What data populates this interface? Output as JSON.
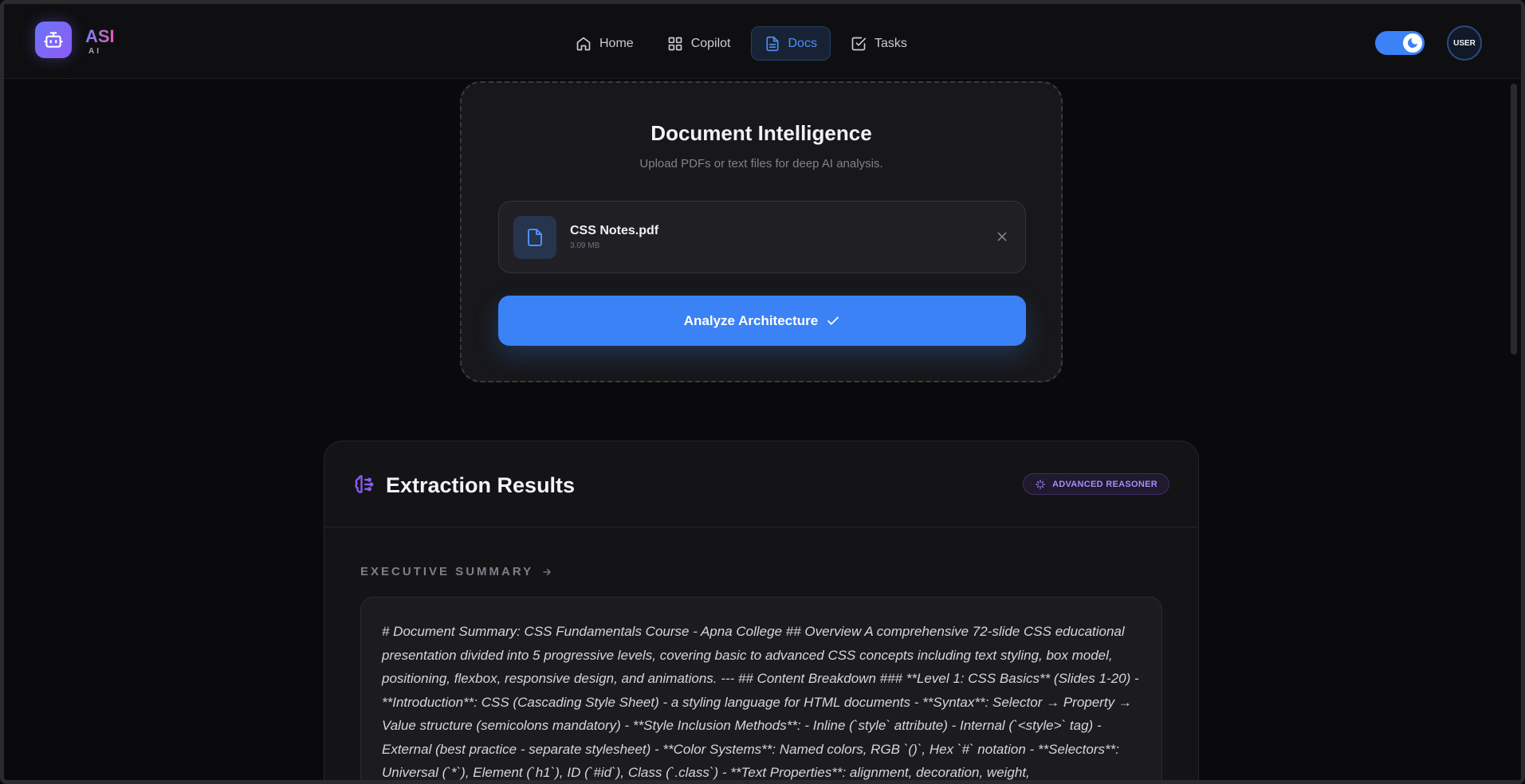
{
  "header": {
    "logo_main": "ASI",
    "logo_sub": "AI",
    "nav": [
      {
        "label": "Home",
        "icon": "home-icon"
      },
      {
        "label": "Copilot",
        "icon": "grid-icon"
      },
      {
        "label": "Docs",
        "icon": "file-icon",
        "active": true
      },
      {
        "label": "Tasks",
        "icon": "checkbox-icon"
      }
    ],
    "theme_toggle": "on",
    "user_label": "USER"
  },
  "upload": {
    "title": "Document Intelligence",
    "subtitle": "Upload PDFs or text files for deep AI analysis.",
    "file": {
      "name": "CSS Notes.pdf",
      "size": "3.09 MB"
    },
    "analyze_label": "Analyze Architecture"
  },
  "results": {
    "title": "Extraction Results",
    "badge": "ADVANCED REASONER",
    "section_label": "EXECUTIVE SUMMARY",
    "summary": "# Document Summary: CSS Fundamentals Course - Apna College ## Overview A comprehensive 72-slide CSS educational presentation divided into 5 progressive levels, covering basic to advanced CSS concepts including text styling, box model, positioning, flexbox, responsive design, and animations. --- ## Content Breakdown ### **Level 1: CSS Basics** (Slides 1-20) - **Introduction**: CSS (Cascading Style Sheet) - a styling language for HTML documents - **Syntax**: Selector → Property → Value structure (semicolons mandatory) - **Style Inclusion Methods**: - Inline (`style` attribute) - Internal (`<style>` tag) - External (best practice - separate stylesheet) - **Color Systems**: Named colors, RGB `()`, Hex `#` notation - **Selectors**: Universal (`*`), Element (`h1`), ID (`#id`), Class (`.class`) - **Text Properties**: alignment, decoration, weight,"
  },
  "colors": {
    "accent": "#3b82f6",
    "badge": "#a78bfa",
    "background": "#0a0a0c"
  }
}
